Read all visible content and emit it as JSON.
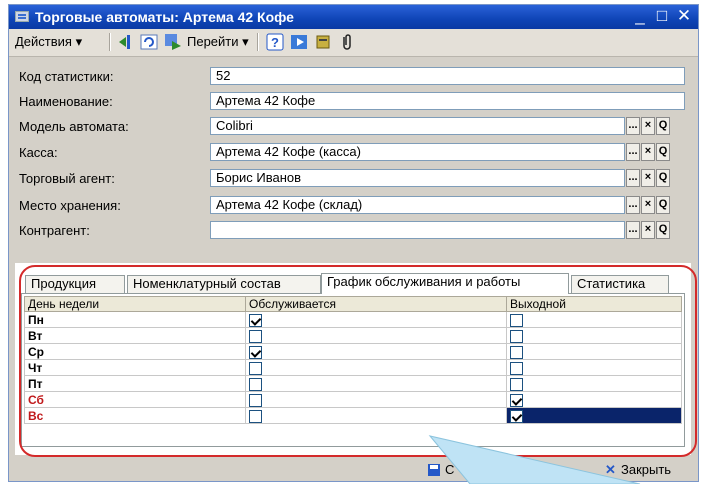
{
  "window": {
    "title": "Торговые автоматы: Артема 42 Кофе",
    "accent": "#0f44b6"
  },
  "toolbar": {
    "actions_label": "Действия ▾",
    "goto_label": "Перейти ▾",
    "help_glyph": "?"
  },
  "fields": [
    {
      "label": "Код статистики:",
      "value": "52",
      "buttons": false
    },
    {
      "label": "Наименование:",
      "value": "Артема 42 Кофе",
      "buttons": false
    },
    {
      "label": "Модель автомата:",
      "value": "Colibri",
      "buttons": true
    },
    {
      "label": "Касса:",
      "value": "Артема 42 Кофе (касса)",
      "buttons": true
    },
    {
      "label": "Торговый агент:",
      "value": "Борис Иванов",
      "buttons": true
    },
    {
      "label": "Место хранения:",
      "value": "Артема 42 Кофе (склад)",
      "buttons": true
    },
    {
      "label": "Контрагент:",
      "value": "",
      "buttons": true
    }
  ],
  "field_buttons": {
    "select": "...",
    "clear": "×",
    "open": "Q"
  },
  "tabs": [
    {
      "label": "Продукция",
      "active": false
    },
    {
      "label": "Номенклатурный состав",
      "active": false
    },
    {
      "label": "График обслуживания и работы",
      "active": true
    },
    {
      "label": "Статистика",
      "active": false
    }
  ],
  "grid": {
    "columns": [
      "День недели",
      "Обслуживается",
      "Выходной"
    ],
    "rows": [
      {
        "day": "Пн",
        "served": true,
        "dayoff": false,
        "weekend": false
      },
      {
        "day": "Вт",
        "served": false,
        "dayoff": false,
        "weekend": false
      },
      {
        "day": "Ср",
        "served": true,
        "dayoff": false,
        "weekend": false
      },
      {
        "day": "Чт",
        "served": false,
        "dayoff": false,
        "weekend": false
      },
      {
        "day": "Пт",
        "served": false,
        "dayoff": false,
        "weekend": false
      },
      {
        "day": "Сб",
        "served": false,
        "dayoff": true,
        "weekend": true
      },
      {
        "day": "Вс",
        "served": false,
        "dayoff": true,
        "weekend": true
      }
    ]
  },
  "bottom": {
    "save_partial": "С",
    "close_label": "Закрыть"
  },
  "colors": {
    "highlight": "#d42a2a",
    "weekend_text": "#c0191b",
    "selection": "#0a246a",
    "callout": "#bfe3f5"
  }
}
